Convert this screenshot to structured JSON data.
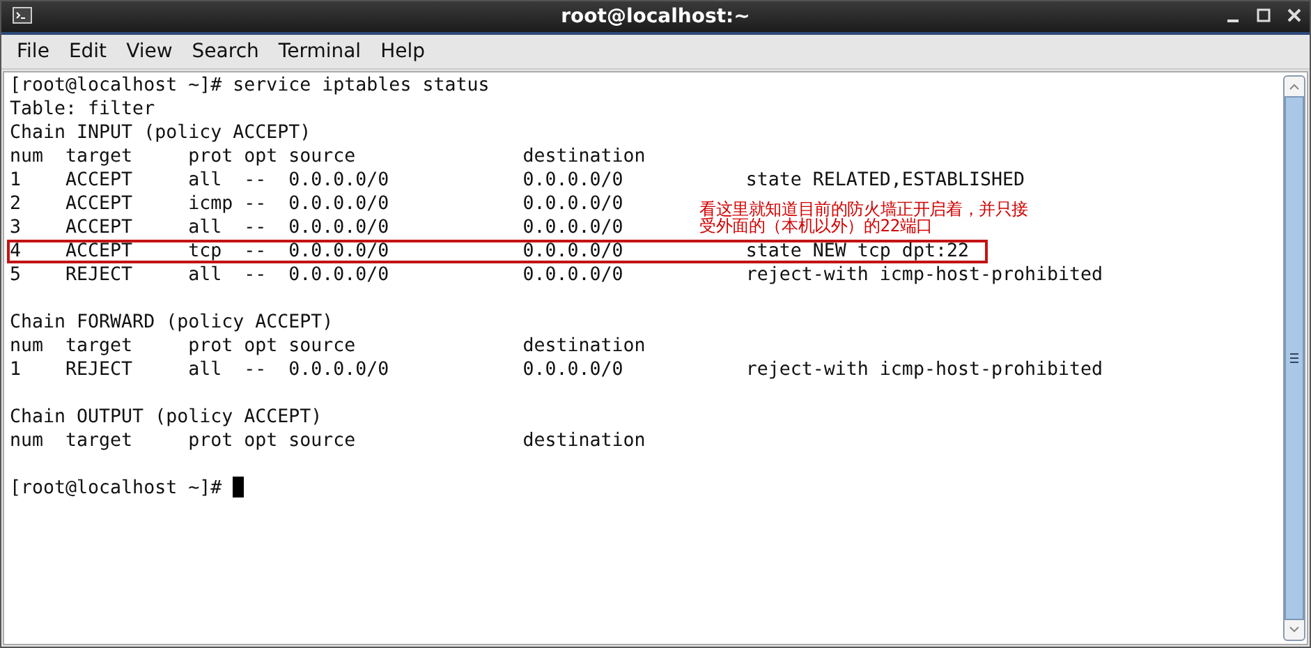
{
  "window": {
    "title": "root@localhost:~"
  },
  "menu": [
    "File",
    "Edit",
    "View",
    "Search",
    "Terminal",
    "Help"
  ],
  "terminal": {
    "blocks": [
      [
        {
          "text": "[root@localhost ~]# service iptables status",
          "highlighted": false
        },
        {
          "text": "Table: filter",
          "highlighted": false
        },
        {
          "text": "Chain INPUT (policy ACCEPT)",
          "highlighted": false
        },
        {
          "text": "num  target     prot opt source               destination",
          "highlighted": false
        },
        {
          "text": "1    ACCEPT     all  --  0.0.0.0/0            0.0.0.0/0           state RELATED,ESTABLISHED",
          "highlighted": false
        },
        {
          "text": "2    ACCEPT     icmp --  0.0.0.0/0            0.0.0.0/0",
          "highlighted": false
        },
        {
          "text": "3    ACCEPT     all  --  0.0.0.0/0            0.0.0.0/0",
          "highlighted": false
        },
        {
          "text": "4    ACCEPT     tcp  --  0.0.0.0/0            0.0.0.0/0           state NEW tcp dpt:22",
          "highlighted": true
        },
        {
          "text": "5    REJECT     all  --  0.0.0.0/0            0.0.0.0/0           reject-with icmp-host-prohibited",
          "highlighted": false
        }
      ],
      [
        {
          "text": "Chain FORWARD (policy ACCEPT)",
          "highlighted": false
        },
        {
          "text": "num  target     prot opt source               destination",
          "highlighted": false
        },
        {
          "text": "1    REJECT     all  --  0.0.0.0/0            0.0.0.0/0           reject-with icmp-host-prohibited",
          "highlighted": false
        }
      ],
      [
        {
          "text": "Chain OUTPUT (policy ACCEPT)",
          "highlighted": false
        },
        {
          "text": "num  target     prot opt source               destination",
          "highlighted": false
        }
      ]
    ],
    "prompt": "[root@localhost ~]# ",
    "annotation": "看这里就知道目前的防火墙正开启着，并只接受外面的（本机以外）的22端口"
  }
}
